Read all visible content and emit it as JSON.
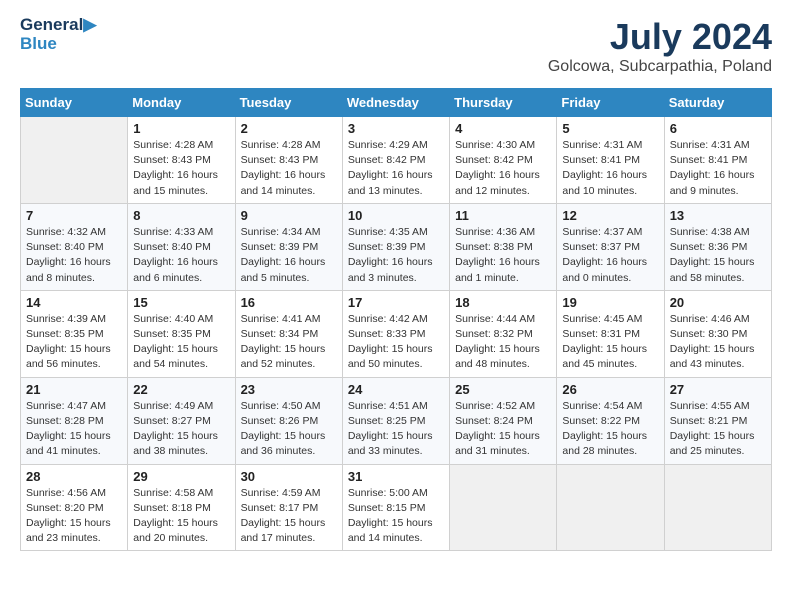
{
  "logo": {
    "line1": "General",
    "line2": "Blue"
  },
  "title": "July 2024",
  "subtitle": "Golcowa, Subcarpathia, Poland",
  "header": {
    "days": [
      "Sunday",
      "Monday",
      "Tuesday",
      "Wednesday",
      "Thursday",
      "Friday",
      "Saturday"
    ]
  },
  "weeks": [
    [
      {
        "day": "",
        "info": ""
      },
      {
        "day": "1",
        "info": "Sunrise: 4:28 AM\nSunset: 8:43 PM\nDaylight: 16 hours\nand 15 minutes."
      },
      {
        "day": "2",
        "info": "Sunrise: 4:28 AM\nSunset: 8:43 PM\nDaylight: 16 hours\nand 14 minutes."
      },
      {
        "day": "3",
        "info": "Sunrise: 4:29 AM\nSunset: 8:42 PM\nDaylight: 16 hours\nand 13 minutes."
      },
      {
        "day": "4",
        "info": "Sunrise: 4:30 AM\nSunset: 8:42 PM\nDaylight: 16 hours\nand 12 minutes."
      },
      {
        "day": "5",
        "info": "Sunrise: 4:31 AM\nSunset: 8:41 PM\nDaylight: 16 hours\nand 10 minutes."
      },
      {
        "day": "6",
        "info": "Sunrise: 4:31 AM\nSunset: 8:41 PM\nDaylight: 16 hours\nand 9 minutes."
      }
    ],
    [
      {
        "day": "7",
        "info": "Sunrise: 4:32 AM\nSunset: 8:40 PM\nDaylight: 16 hours\nand 8 minutes."
      },
      {
        "day": "8",
        "info": "Sunrise: 4:33 AM\nSunset: 8:40 PM\nDaylight: 16 hours\nand 6 minutes."
      },
      {
        "day": "9",
        "info": "Sunrise: 4:34 AM\nSunset: 8:39 PM\nDaylight: 16 hours\nand 5 minutes."
      },
      {
        "day": "10",
        "info": "Sunrise: 4:35 AM\nSunset: 8:39 PM\nDaylight: 16 hours\nand 3 minutes."
      },
      {
        "day": "11",
        "info": "Sunrise: 4:36 AM\nSunset: 8:38 PM\nDaylight: 16 hours\nand 1 minute."
      },
      {
        "day": "12",
        "info": "Sunrise: 4:37 AM\nSunset: 8:37 PM\nDaylight: 16 hours\nand 0 minutes."
      },
      {
        "day": "13",
        "info": "Sunrise: 4:38 AM\nSunset: 8:36 PM\nDaylight: 15 hours\nand 58 minutes."
      }
    ],
    [
      {
        "day": "14",
        "info": "Sunrise: 4:39 AM\nSunset: 8:35 PM\nDaylight: 15 hours\nand 56 minutes."
      },
      {
        "day": "15",
        "info": "Sunrise: 4:40 AM\nSunset: 8:35 PM\nDaylight: 15 hours\nand 54 minutes."
      },
      {
        "day": "16",
        "info": "Sunrise: 4:41 AM\nSunset: 8:34 PM\nDaylight: 15 hours\nand 52 minutes."
      },
      {
        "day": "17",
        "info": "Sunrise: 4:42 AM\nSunset: 8:33 PM\nDaylight: 15 hours\nand 50 minutes."
      },
      {
        "day": "18",
        "info": "Sunrise: 4:44 AM\nSunset: 8:32 PM\nDaylight: 15 hours\nand 48 minutes."
      },
      {
        "day": "19",
        "info": "Sunrise: 4:45 AM\nSunset: 8:31 PM\nDaylight: 15 hours\nand 45 minutes."
      },
      {
        "day": "20",
        "info": "Sunrise: 4:46 AM\nSunset: 8:30 PM\nDaylight: 15 hours\nand 43 minutes."
      }
    ],
    [
      {
        "day": "21",
        "info": "Sunrise: 4:47 AM\nSunset: 8:28 PM\nDaylight: 15 hours\nand 41 minutes."
      },
      {
        "day": "22",
        "info": "Sunrise: 4:49 AM\nSunset: 8:27 PM\nDaylight: 15 hours\nand 38 minutes."
      },
      {
        "day": "23",
        "info": "Sunrise: 4:50 AM\nSunset: 8:26 PM\nDaylight: 15 hours\nand 36 minutes."
      },
      {
        "day": "24",
        "info": "Sunrise: 4:51 AM\nSunset: 8:25 PM\nDaylight: 15 hours\nand 33 minutes."
      },
      {
        "day": "25",
        "info": "Sunrise: 4:52 AM\nSunset: 8:24 PM\nDaylight: 15 hours\nand 31 minutes."
      },
      {
        "day": "26",
        "info": "Sunrise: 4:54 AM\nSunset: 8:22 PM\nDaylight: 15 hours\nand 28 minutes."
      },
      {
        "day": "27",
        "info": "Sunrise: 4:55 AM\nSunset: 8:21 PM\nDaylight: 15 hours\nand 25 minutes."
      }
    ],
    [
      {
        "day": "28",
        "info": "Sunrise: 4:56 AM\nSunset: 8:20 PM\nDaylight: 15 hours\nand 23 minutes."
      },
      {
        "day": "29",
        "info": "Sunrise: 4:58 AM\nSunset: 8:18 PM\nDaylight: 15 hours\nand 20 minutes."
      },
      {
        "day": "30",
        "info": "Sunrise: 4:59 AM\nSunset: 8:17 PM\nDaylight: 15 hours\nand 17 minutes."
      },
      {
        "day": "31",
        "info": "Sunrise: 5:00 AM\nSunset: 8:15 PM\nDaylight: 15 hours\nand 14 minutes."
      },
      {
        "day": "",
        "info": ""
      },
      {
        "day": "",
        "info": ""
      },
      {
        "day": "",
        "info": ""
      }
    ]
  ]
}
